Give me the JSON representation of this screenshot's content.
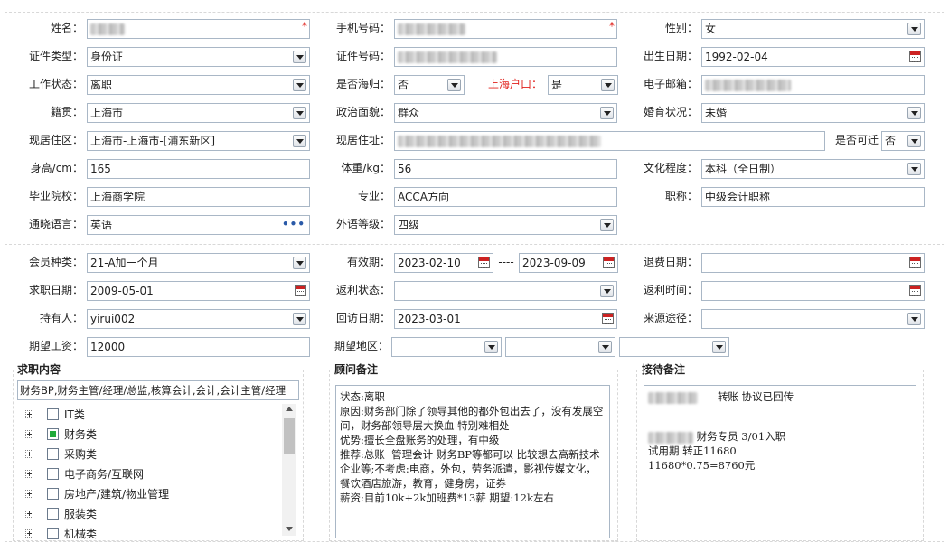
{
  "basic": {
    "name": {
      "label": "姓名："
    },
    "mobile": {
      "label": "手机号码："
    },
    "gender": {
      "label": "性别：",
      "value": "女"
    },
    "id_type": {
      "label": "证件类型：",
      "value": "身份证"
    },
    "id_number": {
      "label": "证件号码："
    },
    "birth": {
      "label": "出生日期：",
      "value": "1992-02-04"
    },
    "work_status": {
      "label": "工作状态：",
      "value": "离职"
    },
    "returnee": {
      "label": "是否海归：",
      "value": "否"
    },
    "shanghai_hukou": {
      "label": "上海户口：",
      "value": "是"
    },
    "email": {
      "label": "电子邮箱："
    },
    "native": {
      "label": "籍贯：",
      "value": "上海市"
    },
    "political": {
      "label": "政治面貌：",
      "value": "群众"
    },
    "marital": {
      "label": "婚育状况：",
      "value": "未婚"
    },
    "residence_area": {
      "label": "现居住区：",
      "value": "上海市-上海市-[浦东新区]"
    },
    "address": {
      "label": "现居住址："
    },
    "relocate": {
      "label": "是否可迁",
      "value": "否"
    },
    "height": {
      "label": "身高/cm：",
      "value": "165"
    },
    "weight": {
      "label": "体重/kg：",
      "value": "56"
    },
    "education": {
      "label": "文化程度：",
      "value": "本科（全日制）"
    },
    "school": {
      "label": "毕业院校：",
      "value": "上海商学院"
    },
    "major": {
      "label": "专业：",
      "value": "ACCA方向"
    },
    "title": {
      "label": "职称：",
      "value": "中级会计职称"
    },
    "language": {
      "label": "通晓语言：",
      "value": "英语"
    },
    "lang_level": {
      "label": "外语等级：",
      "value": "四级"
    }
  },
  "member": {
    "type": {
      "label": "会员种类：",
      "value": "21-A加一个月"
    },
    "valid": {
      "label": "有效期：",
      "from": "2023-02-10",
      "sep": "----",
      "to": "2023-09-09"
    },
    "refund": {
      "label": "退费日期：",
      "value": ""
    },
    "job_date": {
      "label": "求职日期：",
      "value": "2009-05-01"
    },
    "rebate_status": {
      "label": "返利状态：",
      "value": ""
    },
    "rebate_time": {
      "label": "返利时间：",
      "value": ""
    },
    "holder": {
      "label": "持有人：",
      "value": "yirui002"
    },
    "visit_date": {
      "label": "回访日期：",
      "value": "2023-03-01"
    },
    "source": {
      "label": "来源途径：",
      "value": ""
    },
    "salary": {
      "label": "期望工资：",
      "value": "12000"
    },
    "region": {
      "label": "期望地区：",
      "values": [
        "",
        "",
        ""
      ]
    }
  },
  "job_content": {
    "title": "求职内容",
    "summary": "财务BP,财务主管/经理/总监,核算会计,会计,会计主管/经理",
    "tree": [
      {
        "label": "IT类",
        "checked": false
      },
      {
        "label": "财务类",
        "checked": true
      },
      {
        "label": "采购类",
        "checked": false
      },
      {
        "label": "电子商务/互联网",
        "checked": false
      },
      {
        "label": "房地产/建筑/物业管理",
        "checked": false
      },
      {
        "label": "服装类",
        "checked": false
      },
      {
        "label": "机械类",
        "checked": false
      }
    ]
  },
  "advisor_notes": {
    "title": "顾问备注",
    "text": "状态:离职\n原因:财务部门除了领导其他的都外包出去了，没有发展空间，财务部领导层大换血 特别难相处\n优势:擅长全盘账务的处理，有中级\n推荐:总账  管理会计 财务BP等都可以 比较想去高新技术企业等;不考虑:电商，外包，劳务派遣，影视传媒文化，餐饮酒店旅游，教育，健身房，证券\n薪资:目前10k+2k加班费*13薪 期望:12k左右"
  },
  "reception_notes": {
    "title": "接待备注",
    "line1": "转账  协议已回传",
    "line2": "财务专员 3/01入职",
    "line3": "试用期 转正11680",
    "line4": "11680*0.75=8760元"
  },
  "colors": {
    "border": "#a9b7c6",
    "required": "#e0201b",
    "checked": "#1faa3a"
  }
}
